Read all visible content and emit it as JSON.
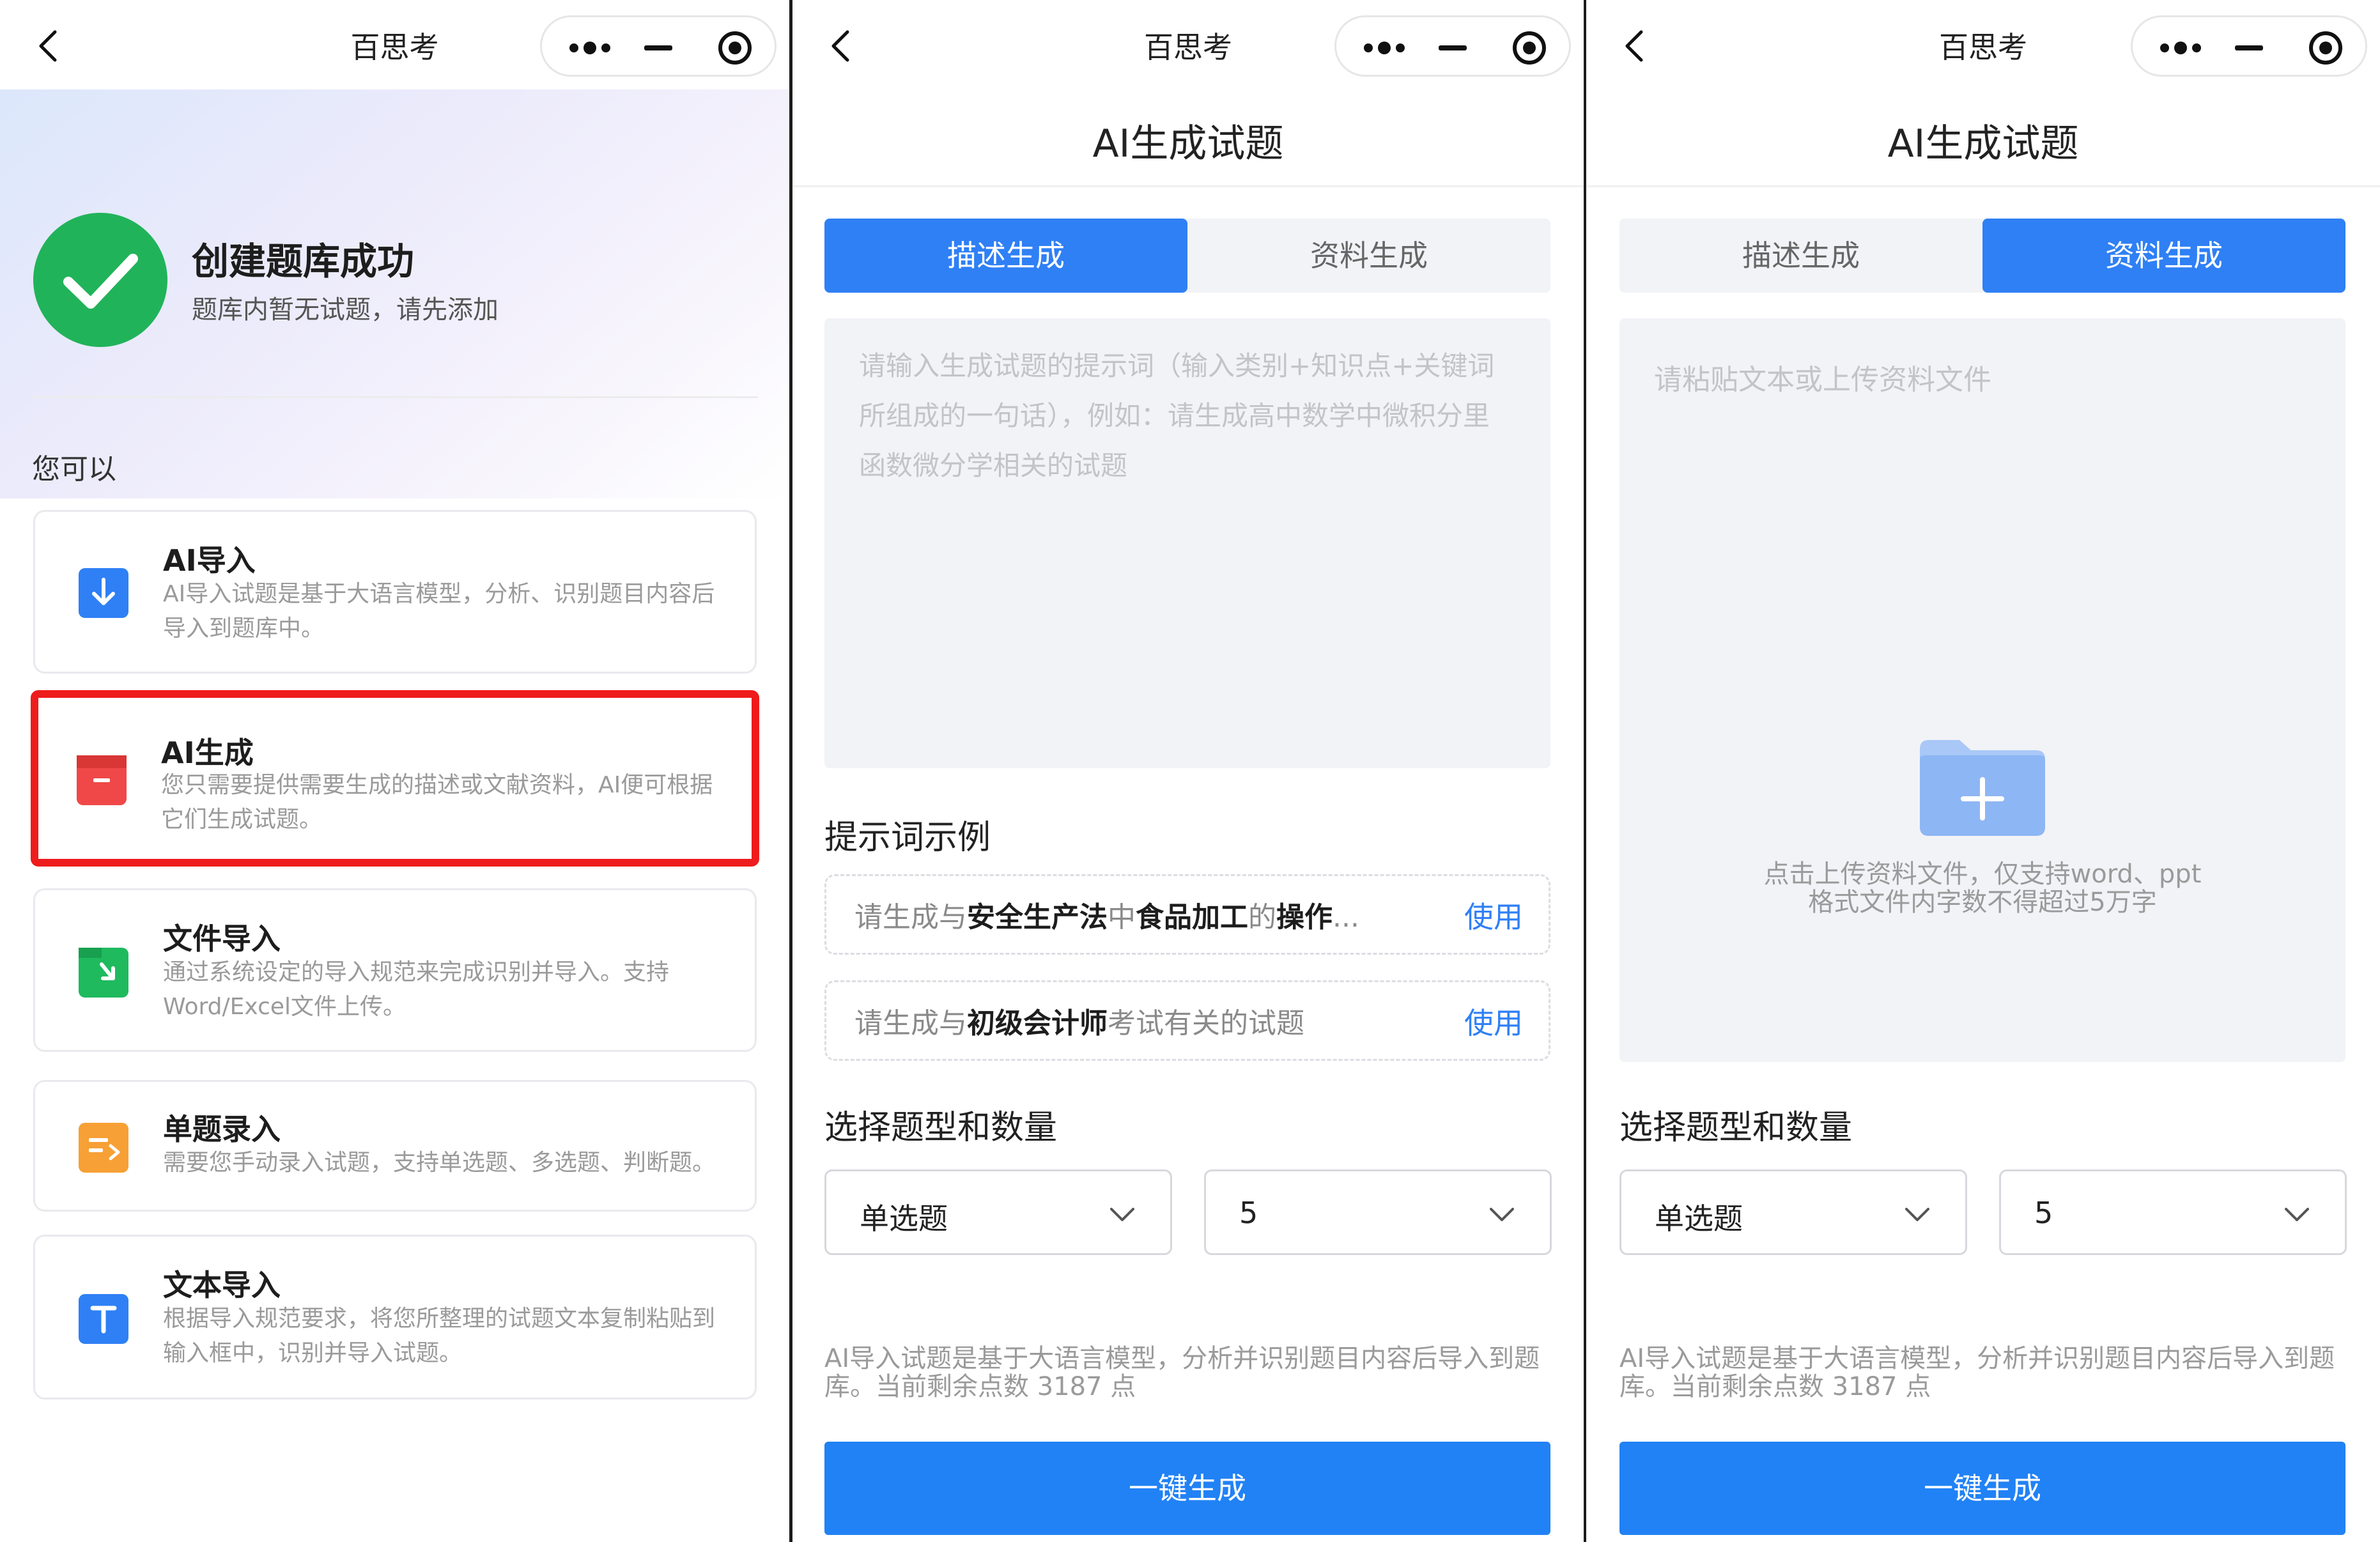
{
  "nav": {
    "title": "百思考"
  },
  "panel1": {
    "success_title": "创建题库成功",
    "success_sub": "题库内暂无试题，请先添加",
    "you_can": "您可以",
    "options": [
      {
        "title": "AI导入",
        "desc": "AI导入试题是基于大语言模型，分析、识别题目内容后导入到题库中。",
        "icon": "download-icon",
        "color": "#2f80f5"
      },
      {
        "title": "AI生成",
        "desc": "您只需要提供需要生成的描述或文献资料，AI便可根据它们生成试题。",
        "icon": "archive-icon",
        "color": "#f04848"
      },
      {
        "title": "文件导入",
        "desc": "通过系统设定的导入规范来完成识别并导入。支持Word/Excel文件上传。",
        "icon": "file-import-icon",
        "color": "#1fba5e"
      },
      {
        "title": "单题录入",
        "desc": "需要您手动录入试题，支持单选题、多选题、判断题。",
        "icon": "single-entry-icon",
        "color": "#f7a035"
      },
      {
        "title": "文本导入",
        "desc": "根据导入规范要求，将您所整理的试题文本复制粘贴到输入框中，识别并导入试题。",
        "icon": "text-import-icon",
        "color": "#2f80f5"
      }
    ]
  },
  "panel2": {
    "page_title": "AI生成试题",
    "tab_describe": "描述生成",
    "tab_material": "资料生成",
    "placeholder": "请输入生成试题的提示词（输入类别+知识点+关键词所组成的一句话），例如：请生成高中数学中微积分里函数微分学相关的试题",
    "examples_label": "提示词示例",
    "example1": {
      "p1": "请生成与",
      "b1": "安全生产法",
      "p2": "中",
      "b2": "食品加工",
      "p3": "的",
      "b3": "操作",
      "p4": "..."
    },
    "example2": {
      "p1": "请生成与",
      "b1": "初级会计师",
      "p2": "考试有关的试题"
    },
    "use_label": "使用",
    "select_label": "选择题型和数量",
    "type_value": "单选题",
    "count_value": "5",
    "note": "AI导入试题是基于大语言模型，分析并识别题目内容后导入到题库。当前剩余点数 3187 点",
    "button": "一键生成"
  },
  "panel3": {
    "page_title": "AI生成试题",
    "tab_describe": "描述生成",
    "tab_material": "资料生成",
    "placeholder": "请粘贴文本或上传资料文件",
    "upload_hint": "点击上传资料文件，仅支持word、ppt格式文件内字数不得超过5万字",
    "select_label": "选择题型和数量",
    "type_value": "单选题",
    "count_value": "5",
    "note": "AI导入试题是基于大语言模型，分析并识别题目内容后导入到题库。当前剩余点数 3187 点",
    "button": "一键生成"
  },
  "colors": {
    "primary": "#2f80f5",
    "button": "#2182f5",
    "success": "#21b35a",
    "highlight": "#ee1c1c"
  }
}
